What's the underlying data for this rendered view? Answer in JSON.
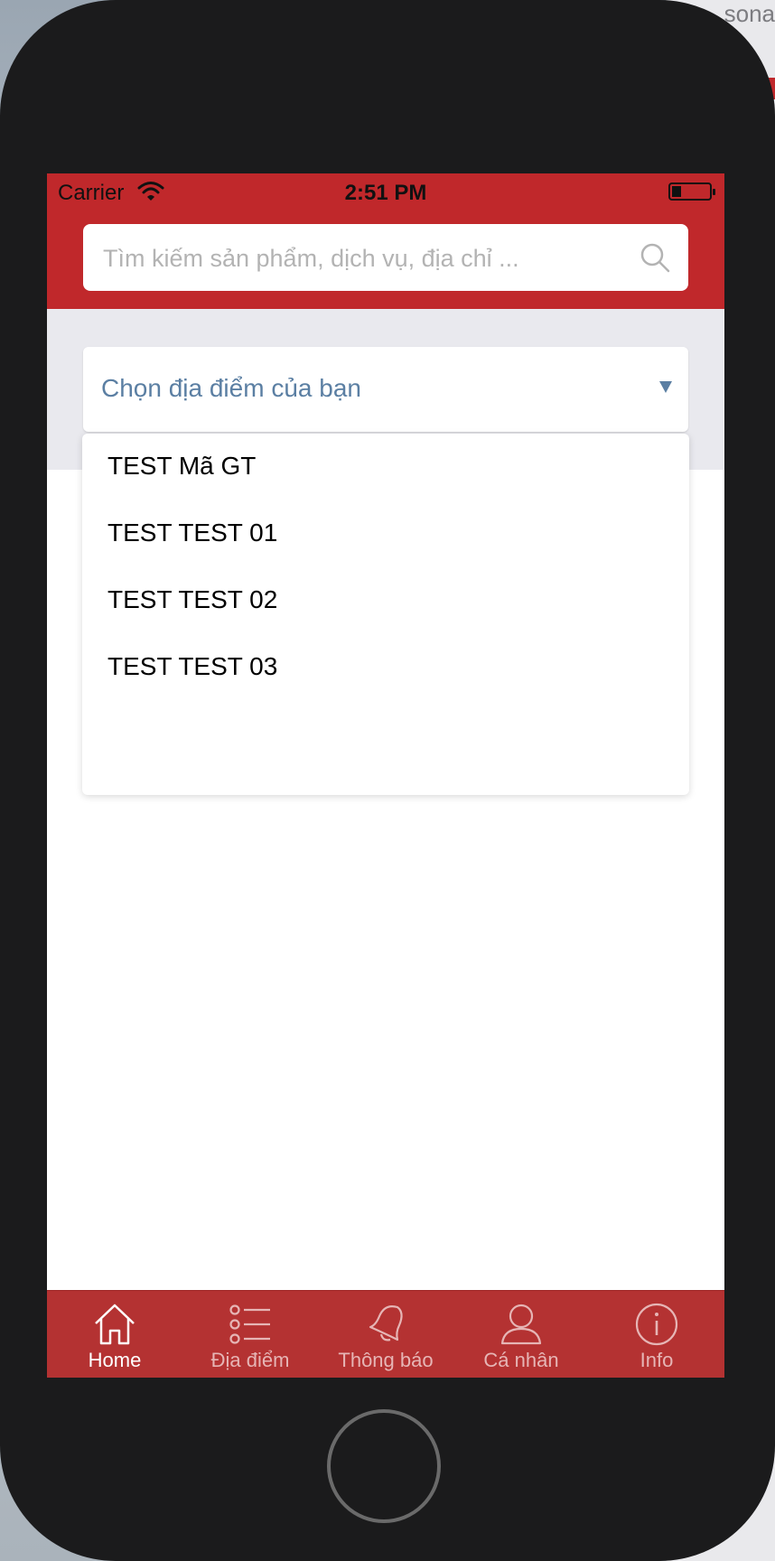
{
  "background_window": {
    "text": "sona"
  },
  "status_bar": {
    "carrier": "Carrier",
    "time": "2:51 PM"
  },
  "search": {
    "placeholder": "Tìm kiếm sản phẩm, dịch vụ, địa chỉ ..."
  },
  "location": {
    "placeholder": "Chọn địa điểm của bạn",
    "options": [
      {
        "label": "TEST Mã GT"
      },
      {
        "label": "TEST TEST 01"
      },
      {
        "label": "TEST TEST 02"
      },
      {
        "label": "TEST TEST 03"
      }
    ]
  },
  "tabs": [
    {
      "label": "Home",
      "icon": "home-icon",
      "active": true
    },
    {
      "label": "Địa điểm",
      "icon": "list-icon",
      "active": false
    },
    {
      "label": "Thông báo",
      "icon": "bell-icon",
      "active": false
    },
    {
      "label": "Cá nhân",
      "icon": "user-icon",
      "active": false
    },
    {
      "label": "Info",
      "icon": "info-icon",
      "active": false
    }
  ],
  "colors": {
    "brand_red": "#c0282b",
    "tab_bar_red": "#b43232",
    "placeholder_blue": "#5b7fa3",
    "device_frame": "#1b1b1c"
  }
}
